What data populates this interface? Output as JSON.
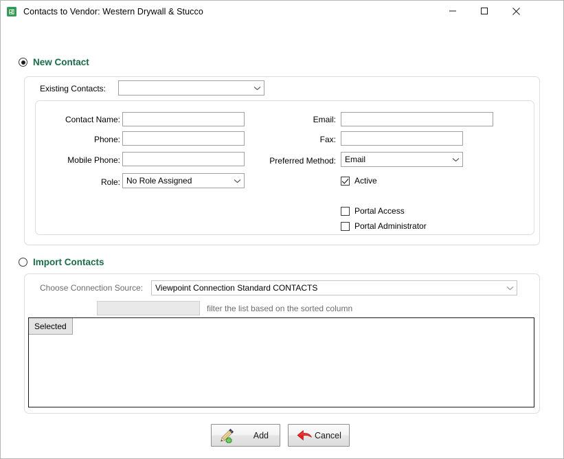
{
  "window": {
    "title": "Contacts to Vendor: Western Drywall & Stucco",
    "app_icon": "contact-card-icon",
    "controls": {
      "minimize": "minimize-icon",
      "maximize": "maximize-icon",
      "close": "close-icon"
    }
  },
  "new_contact_section": {
    "radio_label": "New Contact",
    "radio_selected": true,
    "existing_contacts": {
      "label": "Existing Contacts:",
      "value": "",
      "placeholder": ""
    },
    "fields": {
      "contact_name": {
        "label": "Contact Name:",
        "value": ""
      },
      "phone": {
        "label": "Phone:",
        "value": ""
      },
      "mobile_phone": {
        "label": "Mobile Phone:",
        "value": ""
      },
      "role": {
        "label": "Role:",
        "value": "No Role Assigned"
      },
      "email": {
        "label": "Email:",
        "value": ""
      },
      "fax": {
        "label": "Fax:",
        "value": ""
      },
      "preferred_method": {
        "label": "Preferred Method:",
        "value": "Email"
      }
    },
    "checkboxes": {
      "active": {
        "label": "Active",
        "checked": true
      },
      "portal_access": {
        "label": "Portal Access",
        "checked": false
      },
      "portal_administrator": {
        "label": "Portal Administrator",
        "checked": false
      }
    }
  },
  "import_contacts_section": {
    "radio_label": "Import Contacts",
    "radio_selected": false,
    "connection_source": {
      "label": "Choose Connection Source:",
      "value": "Viewpoint Connection Standard CONTACTS"
    },
    "filter": {
      "value": "",
      "hint": "filter the list based on the sorted column"
    },
    "grid": {
      "columns": [
        "Selected"
      ],
      "rows": []
    }
  },
  "footer": {
    "add_button": {
      "label": "Add",
      "icon": "pen-add-icon"
    },
    "cancel_button": {
      "label": "Cancel",
      "icon": "red-back-arrow-icon"
    }
  },
  "colors": {
    "section_heading": "#1a6b47",
    "disabled_text": "#6d6d6d",
    "grid_border": "#1c1c1c",
    "panel_border": "#dcdcdc"
  }
}
